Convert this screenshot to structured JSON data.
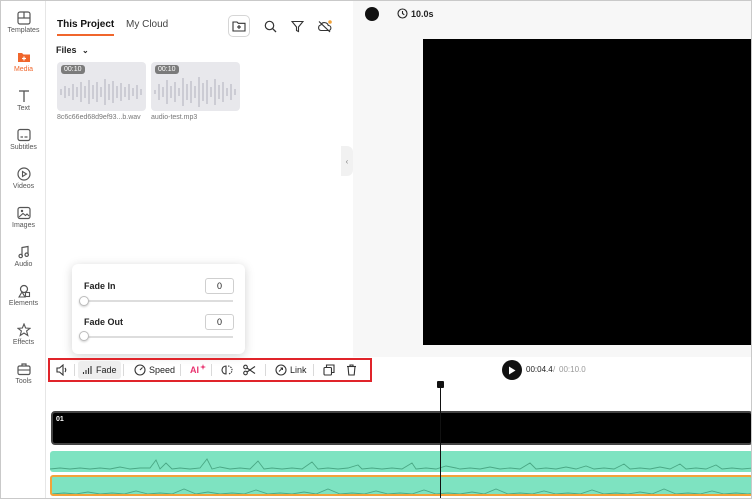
{
  "sidebar": {
    "items": [
      {
        "label": "Templates",
        "icon": "templates-icon"
      },
      {
        "label": "Media",
        "icon": "media-icon",
        "active": true
      },
      {
        "label": "Text",
        "icon": "text-icon"
      },
      {
        "label": "Subtitles",
        "icon": "subtitles-icon"
      },
      {
        "label": "Videos",
        "icon": "videos-icon"
      },
      {
        "label": "Images",
        "icon": "images-icon"
      },
      {
        "label": "Audio",
        "icon": "audio-icon"
      },
      {
        "label": "Elements",
        "icon": "elements-icon"
      },
      {
        "label": "Effects",
        "icon": "effects-icon"
      },
      {
        "label": "Tools",
        "icon": "tools-icon"
      }
    ]
  },
  "media_panel": {
    "tabs": [
      {
        "label": "This Project",
        "active": true
      },
      {
        "label": "My Cloud",
        "active": false
      }
    ],
    "files_label": "Files",
    "files": [
      {
        "duration": "00:10",
        "name": "8c6c66ed68d9ef93...b.wav"
      },
      {
        "duration": "00:10",
        "name": "audio-test.mp3"
      }
    ]
  },
  "preview": {
    "duration_label": "10.0s",
    "background_color": "#000000"
  },
  "fade_popup": {
    "fade_in_label": "Fade In",
    "fade_in_value": "0",
    "fade_out_label": "Fade Out",
    "fade_out_value": "0"
  },
  "toolbar": {
    "fade_label": "Fade",
    "speed_label": "Speed",
    "ai_label": "AI",
    "link_label": "Link"
  },
  "playback": {
    "current_time": "00:04.4",
    "separator": "/",
    "total_time": "00:10.0"
  },
  "timeline": {
    "video_track_label": "01"
  },
  "colors": {
    "accent": "#f0662c",
    "highlight_box": "#e0242a",
    "audio_track": "#7ee3c1",
    "selected_track_border": "#f2a33a"
  }
}
